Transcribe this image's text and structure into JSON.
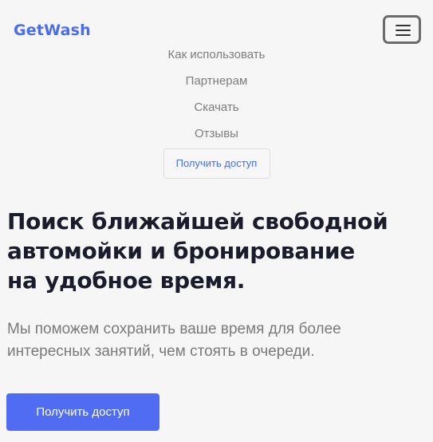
{
  "header": {
    "logo": "GetWash",
    "menu_toggle_icon": "hamburger-icon"
  },
  "nav": {
    "items": [
      {
        "label": "Как использовать"
      },
      {
        "label": "Партнерам"
      },
      {
        "label": "Скачать"
      },
      {
        "label": "Отзывы"
      }
    ],
    "cta_label": "Получить доступ"
  },
  "hero": {
    "title_line1": "Поиск ближайшей свободной",
    "title_line2": "автомойки и бронирование",
    "title_line3": "на удобное время.",
    "subtitle": "Мы поможем сохранить ваше время для более интересных занятий, чем стоять в очереди.",
    "cta_label": "Получить доступ"
  },
  "colors": {
    "accent": "#4f6cf2",
    "logo": "#4a6cf0",
    "background": "#f6f6f6",
    "heading": "#1a1c2b",
    "muted_text": "#7a7a7a"
  }
}
